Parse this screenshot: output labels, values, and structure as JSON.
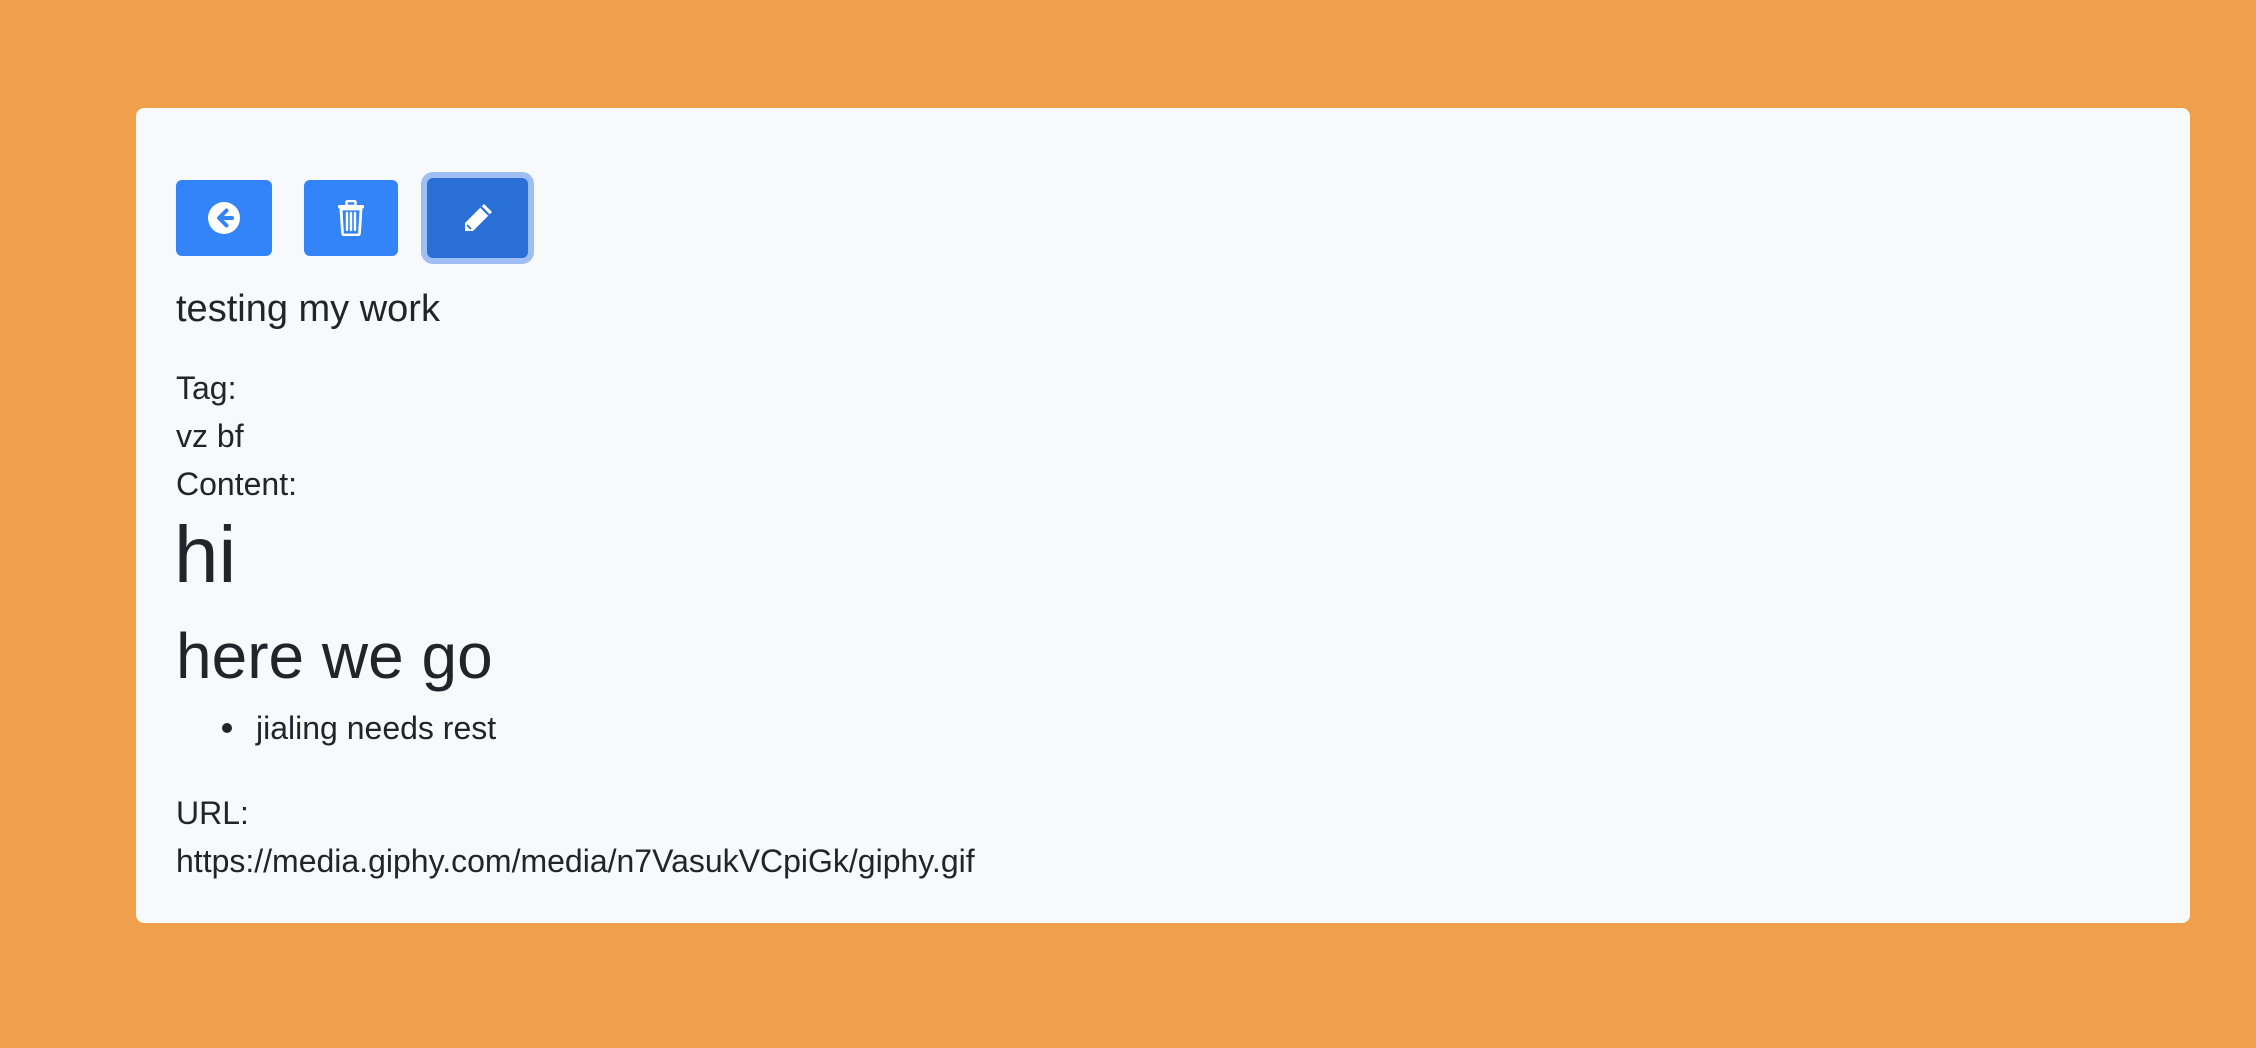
{
  "colors": {
    "page_background": "#F0A04B",
    "card_background": "#F8F9FB",
    "primary_button": "#3384F8",
    "primary_button_active": "#2A6FD6",
    "focus_ring": "#82AAF0",
    "text": "#212529"
  },
  "toolbar": {
    "back_icon": "arrow-circle-left-icon",
    "delete_icon": "trash-icon",
    "edit_icon": "pencil-icon"
  },
  "note": {
    "title": "testing my work",
    "tag_label": "Tag:",
    "tag_value": "vz bf",
    "content_label": "Content:",
    "content": {
      "heading1": "hi",
      "heading2": "here we go",
      "bullets": [
        "jialing needs rest"
      ]
    },
    "url_label": "URL:",
    "url_value": "https://media.giphy.com/media/n7VasukVCpiGk/giphy.gif"
  }
}
